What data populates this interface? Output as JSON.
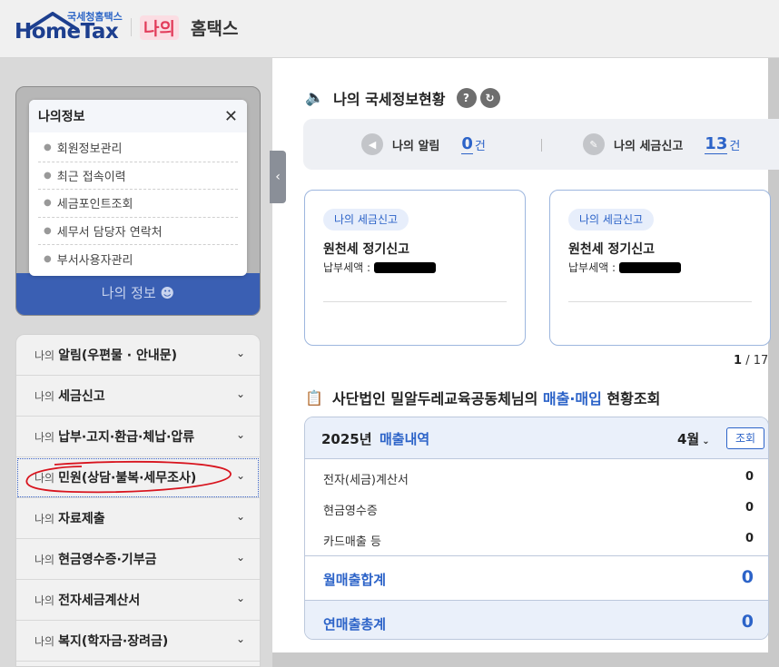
{
  "header": {
    "logo_sub": "국세청홈택스",
    "logo_main": "HomeTax",
    "na": "나의",
    "home": "홈택스"
  },
  "info_popup": {
    "title": "나의정보",
    "items": [
      "회원정보관리",
      "최근 접속이력",
      "세금포인트조회",
      "세무서 담당자 연락처",
      "부서사용자관리"
    ],
    "panel_label": "나의 정보"
  },
  "menu": {
    "items": [
      {
        "pre": "나의",
        "label": "알림(우편물 · 안내문)"
      },
      {
        "pre": "나의",
        "label": "세금신고"
      },
      {
        "pre": "나의",
        "label": "납부·고지·환급·체납·압류"
      },
      {
        "pre": "나의",
        "label": "민원(상담·불복·세무조사)"
      },
      {
        "pre": "나의",
        "label": "자료제출"
      },
      {
        "pre": "나의",
        "label": "현금영수증·기부금"
      },
      {
        "pre": "나의",
        "label": "전자세금계산서"
      },
      {
        "pre": "나의",
        "label": "복지(학자금·장려금)"
      }
    ]
  },
  "status": {
    "title": "나의 국세정보현황",
    "alerts_label": "나의 알림",
    "alerts_count": "0",
    "alerts_unit": "건",
    "tax_label": "나의 세금신고",
    "tax_count": "13",
    "tax_unit": "건"
  },
  "cards": [
    {
      "tag": "나의 세금신고",
      "title": "원천세 정기신고",
      "amount_label": "납부세액 :"
    },
    {
      "tag": "나의 세금신고",
      "title": "원천세 정기신고",
      "amount_label": "납부세액 :"
    }
  ],
  "pager": {
    "current": "1",
    "sep": "/",
    "total": "17"
  },
  "sales": {
    "title_prefix": "사단법인 밀알두레교육공동체님의 ",
    "title_highlight": "매출·매입",
    "title_suffix": " 현황조회",
    "year": "2025년",
    "kind": "매출내역",
    "month": "4월",
    "query_button": "조회",
    "rows": [
      {
        "label": "전자(세금)계산서",
        "value": "0"
      },
      {
        "label": "현금영수증",
        "value": "0"
      },
      {
        "label": "카드매출 등",
        "value": "0"
      }
    ],
    "monthly_label": "월매출합계",
    "monthly_value": "0",
    "yearly_label": "연매출총계",
    "yearly_value": "0"
  },
  "colors": {
    "accent": "#2c63c8",
    "panel_blue": "#3a5fb3",
    "brand_pink": "#e23b5a"
  }
}
